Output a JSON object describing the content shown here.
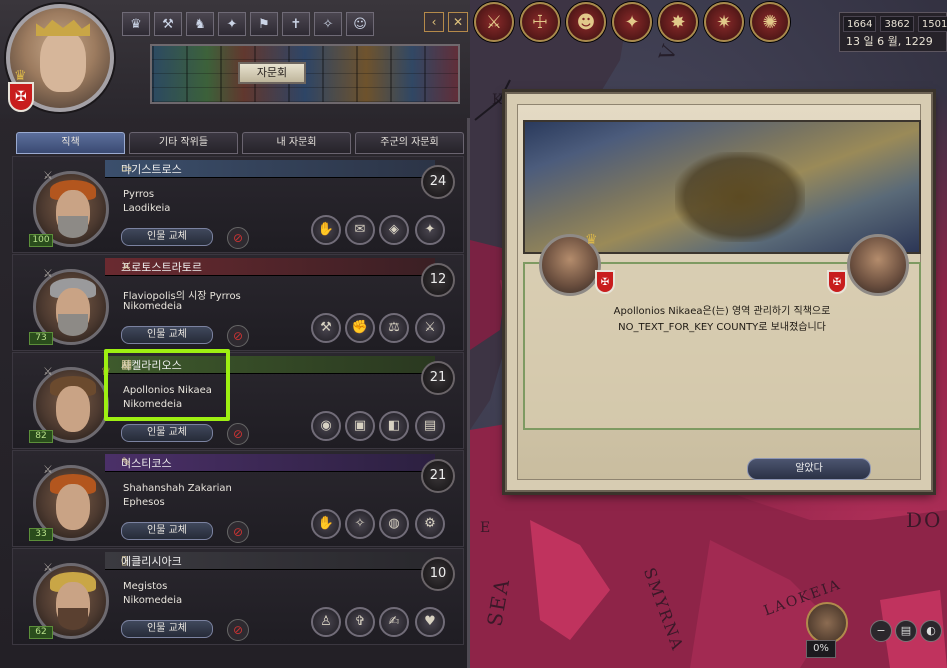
{
  "stats": {
    "gold": "1664",
    "prestige": "3862",
    "piety": "1501",
    "date": "13 일 6 월, 1229"
  },
  "map_labels": [
    "V",
    "K",
    "SEA",
    "DO",
    "SMYRNA",
    "LAOKEIA",
    "E"
  ],
  "header": {
    "title": "자문회"
  },
  "tabs": [
    {
      "label": "직책",
      "active": true
    },
    {
      "label": "기타 작위들",
      "active": false
    },
    {
      "label": "내 자문회",
      "active": false
    },
    {
      "label": "주군의 자문회",
      "active": false
    }
  ],
  "councillors": [
    {
      "title": "마기스트로스",
      "name": "Pyrros",
      "location": "Laodikeia",
      "skill": "100",
      "count": "24",
      "replace": "인물 교체",
      "band_color": "#3b4f6c"
    },
    {
      "title": "프로토스트라토르",
      "name": "Flaviopolis의 시장 Pyrros",
      "location": "Nikomedeia",
      "skill": "73",
      "count": "12",
      "replace": "인물 교체",
      "band_color": "#6a2a30"
    },
    {
      "title": "사켈라리오스",
      "name": "Apollonios Nikaea",
      "location": "Nikomedeia",
      "skill": "82",
      "count": "21",
      "replace": "인물 교체",
      "band_color": "#3e5a2c"
    },
    {
      "title": "미스티코스",
      "name": "Shahanshah Zakarian",
      "location": "Ephesos",
      "skill": "33",
      "count": "21",
      "replace": "인물 교체",
      "band_color": "#4b3068"
    },
    {
      "title": "에클리시아크",
      "name": "Megistos",
      "location": "Nikomedeia",
      "skill": "62",
      "count": "10",
      "replace": "인물 교체",
      "band_color": "#3b3a40"
    }
  ],
  "event": {
    "line1": "Apollonios Nikaea은(는) 영역 관리하기 직책으로",
    "line2": "NO_TEXT_FOR_KEY COUNTY로 보내졌습니다",
    "ok_label": "알았다"
  },
  "map_bottom": {
    "percent": "0%"
  }
}
